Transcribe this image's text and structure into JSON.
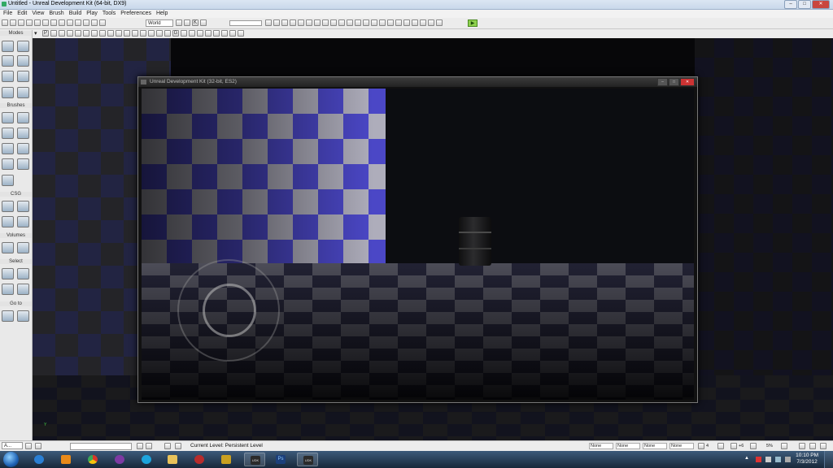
{
  "window": {
    "title": "Untitled - Unreal Development Kit (64-bit, DX9)",
    "controls": {
      "minimize": "–",
      "maximize": "□",
      "close": "✕"
    }
  },
  "menu": {
    "items": [
      "File",
      "Edit",
      "View",
      "Brush",
      "Build",
      "Play",
      "Tools",
      "Preferences",
      "Help"
    ]
  },
  "toolbar": {
    "coord_system": "World",
    "letters": {
      "p": "P",
      "g": "G",
      "k": "K"
    },
    "play_glyph": "▶"
  },
  "sidebar": {
    "sections": [
      "Modes",
      "Brushes",
      "CSG",
      "Volumes",
      "Select",
      "Go to"
    ]
  },
  "game_window": {
    "title": "Unreal Development Kit (32-bit, ES2)",
    "controls": {
      "minimize": "–",
      "maximize": "□",
      "close": "✕"
    }
  },
  "viewport": {
    "axis_label": "Y"
  },
  "statusbar": {
    "current_level": "Current Level:  Persistent Level",
    "task_label": "A...",
    "fields": [
      "None",
      "None",
      "None",
      "None"
    ],
    "grid_value": "4",
    "rotation_value": "+6",
    "scale_value": "5%"
  },
  "taskbar": {
    "apps": [
      {
        "name": "internet-explorer",
        "color": "#2a7fd4"
      },
      {
        "name": "media-player",
        "color": "#e88a1a"
      },
      {
        "name": "chrome",
        "color": "#d8382a"
      },
      {
        "name": "app-purple",
        "color": "#7d3aa3"
      },
      {
        "name": "skype",
        "color": "#1da4dd"
      },
      {
        "name": "explorer",
        "color": "#e8c25a"
      },
      {
        "name": "app-red",
        "color": "#b82c2c"
      },
      {
        "name": "app-yellow",
        "color": "#c9a021"
      },
      {
        "name": "udk",
        "color": "#2b2b2b"
      },
      {
        "name": "photoshop",
        "color": "#1c3f7a"
      },
      {
        "name": "udk-2",
        "color": "#2b2b2b"
      }
    ],
    "udk_label": "UDK",
    "ps_label": "Ps",
    "tray_arrow": "▲",
    "time": "10:10 PM",
    "date": "7/3/2012"
  },
  "colors": {
    "accent": "#1e62b4",
    "close_red": "#c9463d",
    "wall_blue": "#4f4bd1",
    "play_green": "#8fd14f"
  }
}
